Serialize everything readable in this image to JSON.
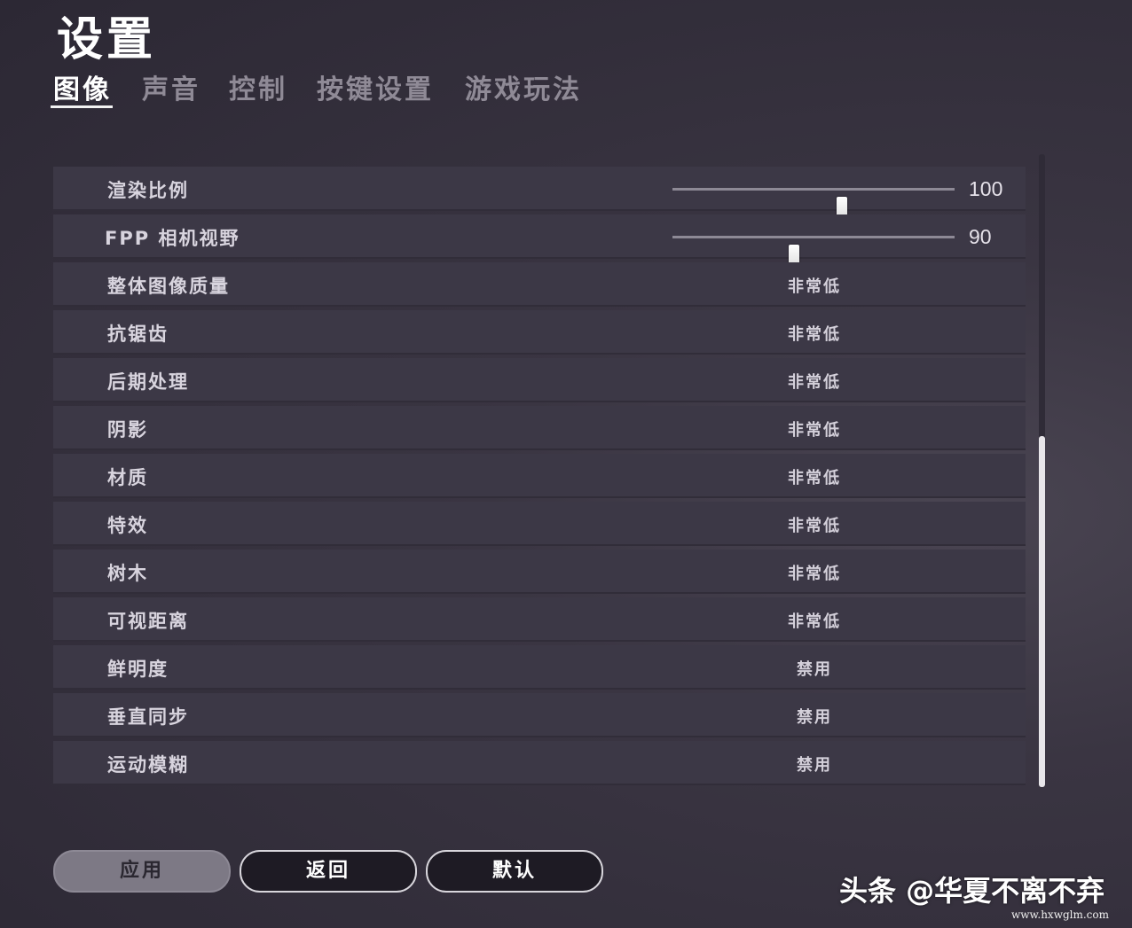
{
  "title": "设置",
  "tabs": [
    {
      "label": "图像"
    },
    {
      "label": "声音"
    },
    {
      "label": "控制"
    },
    {
      "label": "按键设置"
    },
    {
      "label": "游戏玩法"
    }
  ],
  "sliders": [
    {
      "label": "渲染比例",
      "value": "100",
      "level": 0.6
    },
    {
      "label": "FPP 相机视野",
      "value": "90",
      "level": 0.43
    }
  ],
  "options": [
    {
      "label": "整体图像质量",
      "value": "非常低"
    },
    {
      "label": "抗锯齿",
      "value": "非常低"
    },
    {
      "label": "后期处理",
      "value": "非常低"
    },
    {
      "label": "阴影",
      "value": "非常低"
    },
    {
      "label": "材质",
      "value": "非常低"
    },
    {
      "label": "特效",
      "value": "非常低"
    },
    {
      "label": "树木",
      "value": "非常低"
    },
    {
      "label": "可视距离",
      "value": "非常低"
    },
    {
      "label": "鲜明度",
      "value": "禁用"
    },
    {
      "label": "垂直同步",
      "value": "禁用"
    },
    {
      "label": "运动模糊",
      "value": "禁用"
    }
  ],
  "buttons": {
    "apply": "应用",
    "back": "返回",
    "default": "默认"
  },
  "watermark": "头条 @华夏不离不弃",
  "site": "www.hxwglm.com",
  "colors": {
    "active_tab": "#ffffff",
    "inactive_tab": "#8f8a96",
    "row_bg": "#3c3846"
  }
}
